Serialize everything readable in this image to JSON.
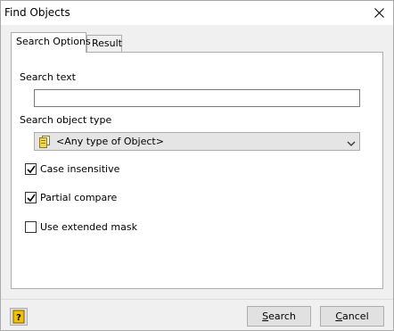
{
  "window": {
    "title": "Find Objects"
  },
  "tabs": [
    {
      "label": "Search Options",
      "active": true
    },
    {
      "label": "Result",
      "active": false
    }
  ],
  "form": {
    "search_text_label": "Search text",
    "search_text_value": "",
    "object_type_label": "Search object type",
    "object_type_value": "<Any type of Object>",
    "options": [
      {
        "label": "Case insensitive",
        "checked": true
      },
      {
        "label": "Partial compare",
        "checked": true
      },
      {
        "label": "Use extended mask",
        "checked": false
      }
    ]
  },
  "buttons": {
    "search_first": "S",
    "search_rest": "earch",
    "cancel_first": "C",
    "cancel_rest": "ancel"
  },
  "icons": {
    "close": "close-icon",
    "object_type": "object-type-icon",
    "dropdown": "chevron-down-icon",
    "help": "help-icon"
  },
  "colors": {
    "panel_bg": "#ffffff",
    "window_bg": "#f0f0f0",
    "help_icon": "#f2c200"
  }
}
